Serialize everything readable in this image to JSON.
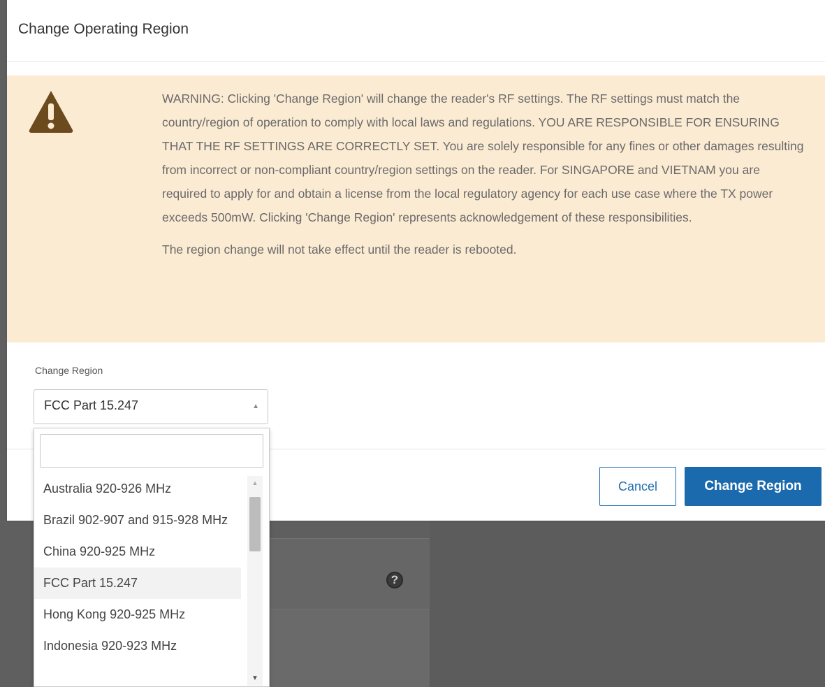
{
  "dialog": {
    "title": "Change Operating Region"
  },
  "warning": {
    "icon": "warning-triangle-icon",
    "text": "WARNING: Clicking 'Change Region' will change the reader's RF settings. The RF settings must match the country/region of operation to comply with local laws and regulations. YOU ARE RESPONSIBLE FOR ENSURING THAT THE RF SETTINGS ARE CORRECTLY SET. You are solely responsible for any fines or other damages resulting from incorrect or non-compliant country/region settings on the reader. For SINGAPORE and VIETNAM you are required to apply for and obtain a license from the local regulatory agency for each use case where the TX power exceeds 500mW. Clicking 'Change Region' represents acknowledgement of these responsibilities.",
    "note": "The region change will not take effect until the reader is rebooted.",
    "background": "#fcebd3",
    "icon_color": "#6b4a1e"
  },
  "region_select": {
    "label": "Change Region",
    "value": "FCC Part 15.247",
    "search_value": "",
    "options": [
      "Australia 920-926 MHz",
      "Brazil 902-907 and 915-928 MHz",
      "China 920-925 MHz",
      "FCC Part 15.247",
      "Hong Kong 920-925 MHz",
      "Indonesia 920-923 MHz"
    ],
    "selected_index": 3
  },
  "footer": {
    "cancel_label": "Cancel",
    "change_label": "Change Region",
    "accent": "#1a6aad"
  },
  "backdrop": {
    "help_icon": "?"
  }
}
